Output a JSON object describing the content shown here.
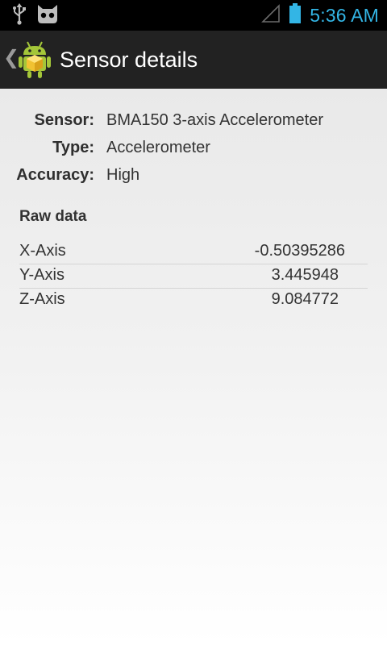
{
  "status_bar": {
    "time": "5:36 AM",
    "icons": [
      "usb-icon",
      "cyanogen-mascot-icon",
      "signal-icon",
      "battery-icon"
    ],
    "time_color": "#33b5e5"
  },
  "action_bar": {
    "title": "Sensor details",
    "up_icon": "chevron-left-icon",
    "app_icon": "android-robot-icon"
  },
  "details": {
    "sensor_label": "Sensor:",
    "sensor_value": "BMA150 3-axis Accelerometer",
    "type_label": "Type:",
    "type_value": "Accelerometer",
    "accuracy_label": "Accuracy:",
    "accuracy_value": "High"
  },
  "raw_data": {
    "title": "Raw data",
    "rows": [
      {
        "axis": "X-Axis",
        "value": "-0.50395286"
      },
      {
        "axis": "Y-Axis",
        "value": "3.445948"
      },
      {
        "axis": "Z-Axis",
        "value": "9.084772"
      }
    ]
  }
}
